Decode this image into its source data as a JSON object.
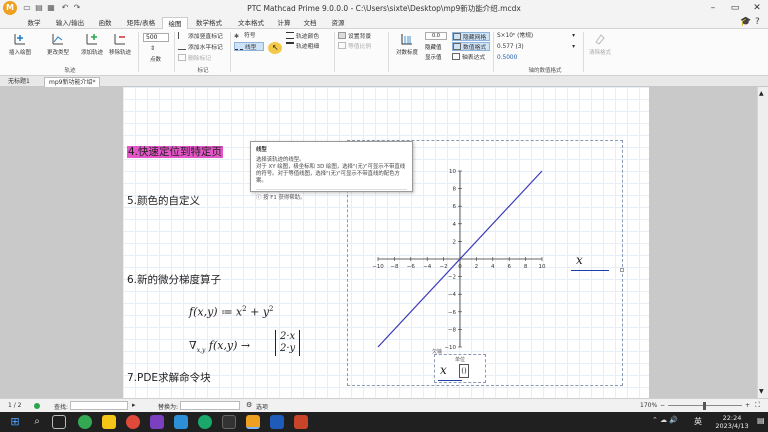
{
  "window": {
    "title": "PTC Mathcad Prime 9.0.0.0 - C:\\Users\\sixte\\Desktop\\mp9新功能介绍.mcdx",
    "app_icon_text": "M"
  },
  "menu": {
    "tabs": [
      "数学",
      "输入/输出",
      "函数",
      "矩阵/表格",
      "绘图",
      "数学格式",
      "文本格式",
      "计算",
      "文档",
      "资源"
    ],
    "active_index": 4
  },
  "ribbon": {
    "insert_plot": "插入绘图",
    "change_type": "更改类型",
    "add_trace": "添加轨迹",
    "remove_trace": "移除轨迹",
    "group_trace": "轨迹",
    "points_value": "500",
    "points_label": "点数",
    "add_vertical_marker": "添加竖直标记",
    "add_horizontal_marker": "添加水平标记",
    "delete_marker": "删除标记",
    "group_marker": "标记",
    "symbol": "符号",
    "line_type": "线型",
    "trace_color": "轨迹颜色",
    "trace_thickness": "轨迹粗细",
    "set_background": "设置背景",
    "equal_ratio": "等值比例",
    "log_scale": "对数标度",
    "hide_grid": "隐藏网格",
    "hide_as_variable": "隐藏值",
    "expression": "轴表达式",
    "numeric_format": "数值格式",
    "show_in_label": "显示值",
    "value_format": "S×10ⁿ (常规)",
    "value_precision": "0.577 (3)",
    "value_sample": "0.5000",
    "group_axis_format": "轴的数值格式",
    "clear_format": "清除格式"
  },
  "tooltip": {
    "title": "线型",
    "line1": "选择该轨迹的线型。",
    "line2": "对于 XY 绘图，极坐标和 3D 绘图，选择\"(无)\"可显示不带直线的符号。对于等值线图，选择\"(无)\"可显示不带直线的配色方案。",
    "help": "按 F1 获得帮助。"
  },
  "doc_tabs": [
    "无标题1",
    "mp9新功能介绍*"
  ],
  "content": {
    "heading4": "4.快速定位到特定页",
    "heading5": "5.颜色的自定义",
    "heading6": "6.新的微分梯度算子",
    "heading7": "7.PDE求解命令块",
    "plot_axis_label": "x",
    "units_label": "单位",
    "units_var": "x",
    "units_inner": "()",
    "units_tab": "欠输"
  },
  "chart_data": {
    "type": "line",
    "series": [
      {
        "x": [
          -10,
          10
        ],
        "y": [
          -10,
          10
        ]
      }
    ],
    "xlim": [
      -10,
      10
    ],
    "ylim": [
      -10,
      10
    ],
    "xticks": [
      "−10",
      "−8",
      "−6",
      "−4",
      "−2",
      "0",
      "2",
      "4",
      "6",
      "8",
      "10"
    ],
    "yticks": [
      "10",
      "8",
      "6",
      "4",
      "2",
      "0",
      "−2",
      "−4",
      "−6",
      "−8",
      "−10"
    ],
    "color": "#3a3ab8",
    "grid": false
  },
  "status": {
    "page": "1 / 2",
    "find_label": "查找:",
    "replace_label": "替换为:",
    "options_label": "选项",
    "zoom": "170%"
  },
  "taskbar": {
    "time": "22:24",
    "date": "2023/4/13",
    "lang": "英"
  },
  "colors": {
    "highlight": "#e455c7",
    "trace": "#3a3ab8",
    "ribbon_bg": "#fbfbfb",
    "taskbar": "#202020"
  }
}
